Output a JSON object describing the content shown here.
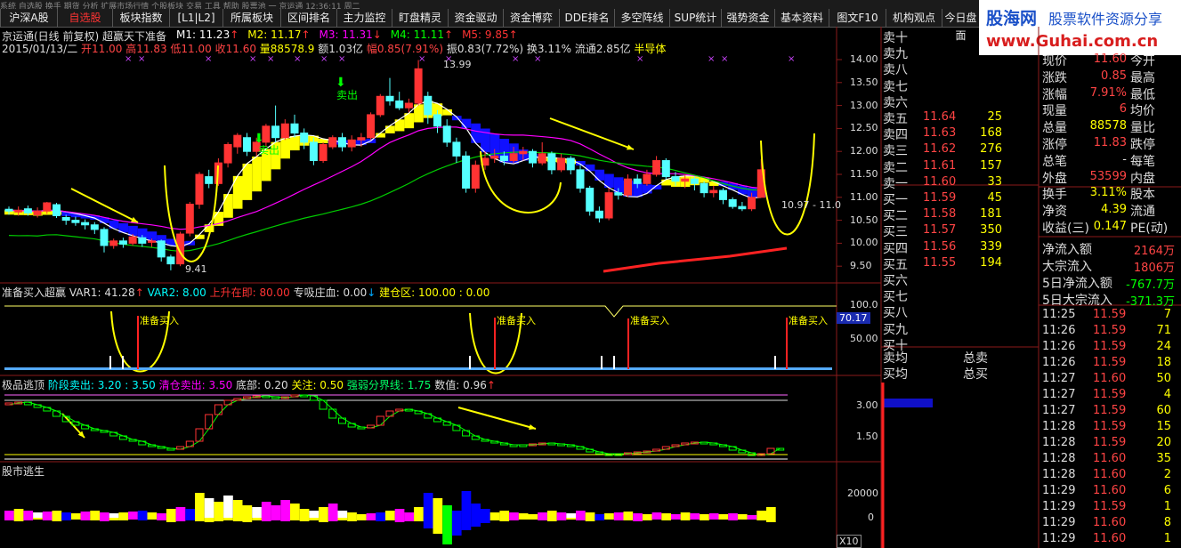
{
  "toolbar": {
    "top_strip": "系统 自选股 换手 期货 分析 扩展市场行情 个股板块 交易 工具 帮助 股票池 一 京运通 12:36:11 周二",
    "tabs": [
      {
        "label": "沪深A股",
        "active": false
      },
      {
        "label": "自选股",
        "active": true
      },
      {
        "label": "板块指数",
        "active": false
      },
      {
        "label": "[L1|L2]",
        "active": false
      },
      {
        "label": "所属板块",
        "active": false
      },
      {
        "label": "区间排名",
        "active": false
      },
      {
        "label": "主力监控",
        "active": false
      },
      {
        "label": "盯盘精灵",
        "active": false
      },
      {
        "label": "资金驱动",
        "active": false
      },
      {
        "label": "资金博弈",
        "active": false
      },
      {
        "label": "DDE排名",
        "active": false
      },
      {
        "label": "多空阵线",
        "active": false
      },
      {
        "label": "SUP统计",
        "active": false
      },
      {
        "label": "强势资金",
        "active": false
      },
      {
        "label": "基本资料",
        "active": false
      },
      {
        "label": "图文F10",
        "active": false
      },
      {
        "label": "机构观点",
        "active": false
      },
      {
        "label": "今日盘面",
        "active": false
      }
    ]
  },
  "watermark": {
    "site_cn": "股海网",
    "slogan": "股票软件资源分享",
    "url": "www.Guhai.com.cn"
  },
  "main_chart": {
    "title": "京运通(日线 前复权) 超赢天下准备",
    "ma": [
      {
        "label": "M1: 11.23",
        "arrow": "↑",
        "color": "#ffffff"
      },
      {
        "label": "M2: 11.17",
        "arrow": "↑",
        "color": "#ffff00"
      },
      {
        "label": "M3: 11.31",
        "arrow": "↓",
        "color": "#ff00ff"
      },
      {
        "label": "M4: 11.11",
        "arrow": "↑",
        "color": "#00ff00"
      },
      {
        "label": "M5: 9.85",
        "arrow": "↑",
        "color": "#ff3333"
      }
    ],
    "date": "2015/01/13/二",
    "open": "开11.00",
    "high": "高11.83",
    "low": "低11.00",
    "close": "收11.60",
    "vol": "量88578.9",
    "amt": "额1.03亿",
    "chg": "幅0.85(7.91%)",
    "amp": "振0.83(7.72%)",
    "turn": "换3.11%",
    "float": "流通2.85亿",
    "sector": "半导体",
    "sell_label": "卖出",
    "high_mark": "13.99",
    "low_mark": "9.41",
    "last_mark": "10.97 - 11.0",
    "yticks": [
      "14.00",
      "13.50",
      "13.00",
      "12.50",
      "12.00",
      "11.50",
      "11.00",
      "10.50",
      "10.00",
      "9.50"
    ]
  },
  "panel2": {
    "title": "准备买入超赢",
    "var1": "VAR1: 41.28",
    "var2": "VAR2: 8.00",
    "up": "上升在即: 80.00",
    "zhuang": "专吸庄血: 0.00",
    "jian": "建仓区: 100.00 : 0.00",
    "buy_label": "准备买入",
    "yticks": [
      "100.0",
      "50.00"
    ],
    "cur": "70.17"
  },
  "panel3": {
    "title": "极品逃顶",
    "s1": "阶段卖出: 3.20 : 3.50",
    "s2": "清仓卖出: 3.50",
    "s3": "底部: 0.20",
    "s4": "关注: 0.50",
    "s5": "强弱分界线: 1.75",
    "s6": "数值: 0.96",
    "yticks": [
      "3.00",
      "1.50"
    ]
  },
  "panel4": {
    "title": "股市逃生",
    "yticks": [
      "20000",
      "0"
    ],
    "scale": "X10"
  },
  "orderbook": {
    "sell": [
      {
        "label": "卖十",
        "price": "",
        "vol": ""
      },
      {
        "label": "卖九",
        "price": "",
        "vol": ""
      },
      {
        "label": "卖八",
        "price": "",
        "vol": ""
      },
      {
        "label": "卖七",
        "price": "",
        "vol": ""
      },
      {
        "label": "卖六",
        "price": "",
        "vol": ""
      },
      {
        "label": "卖五",
        "price": "11.64",
        "vol": "25"
      },
      {
        "label": "卖四",
        "price": "11.63",
        "vol": "168"
      },
      {
        "label": "卖三",
        "price": "11.62",
        "vol": "276"
      },
      {
        "label": "卖二",
        "price": "11.61",
        "vol": "157"
      },
      {
        "label": "卖一",
        "price": "11.60",
        "vol": "33"
      }
    ],
    "buy": [
      {
        "label": "买一",
        "price": "11.59",
        "vol": "45"
      },
      {
        "label": "买二",
        "price": "11.58",
        "vol": "181"
      },
      {
        "label": "买三",
        "price": "11.57",
        "vol": "350"
      },
      {
        "label": "买四",
        "price": "11.56",
        "vol": "339"
      },
      {
        "label": "买五",
        "price": "11.55",
        "vol": "194"
      },
      {
        "label": "买六",
        "price": "",
        "vol": ""
      },
      {
        "label": "买七",
        "price": "",
        "vol": ""
      },
      {
        "label": "买八",
        "price": "",
        "vol": ""
      },
      {
        "label": "买九",
        "price": "",
        "vol": ""
      },
      {
        "label": "买十",
        "price": "",
        "vol": ""
      }
    ],
    "avg_sell": "卖均",
    "avg_buy": "买均",
    "total_sell": "总卖",
    "total_buy": "总买"
  },
  "quote": [
    {
      "label": "现价",
      "value": "11.60",
      "color": "#ff4444",
      "label2": "今开"
    },
    {
      "label": "涨跌",
      "value": "0.85",
      "color": "#ff4444",
      "label2": "最高"
    },
    {
      "label": "涨幅",
      "value": "7.91%",
      "color": "#ff4444",
      "label2": "最低"
    },
    {
      "label": "现量",
      "value": "6",
      "color": "#ff4444",
      "label2": "均价"
    },
    {
      "label": "总量",
      "value": "88578",
      "color": "#ffff00",
      "label2": "量比"
    },
    {
      "label": "涨停",
      "value": "11.83",
      "color": "#ff4444",
      "label2": "跌停"
    },
    {
      "label": "总笔",
      "value": "-",
      "color": "#dddddd",
      "label2": "每笔"
    },
    {
      "label": "外盘",
      "value": "53599",
      "color": "#ff4444",
      "label2": "内盘"
    },
    {
      "label": "换手",
      "value": "3.11%",
      "color": "#ffff00",
      "label2": "股本"
    },
    {
      "label": "净资",
      "value": "4.39",
      "color": "#ffff00",
      "label2": "流通"
    },
    {
      "label": "收益(三)",
      "value": "0.147",
      "color": "#ffff00",
      "label2": "PE(动)"
    }
  ],
  "flows": [
    {
      "label": "净流入额",
      "value": "2164万",
      "color": "#ff4444"
    },
    {
      "label": "大宗流入",
      "value": "1806万",
      "color": "#ff4444"
    },
    {
      "label": "5日净流入额",
      "value": "-767.7万",
      "color": "#00ff00"
    },
    {
      "label": "5日大宗流入",
      "value": "-371.3万",
      "color": "#00ff00"
    }
  ],
  "ticks": [
    {
      "time": "11:25",
      "price": "11.59",
      "vol": "7"
    },
    {
      "time": "11:26",
      "price": "11.59",
      "vol": "71"
    },
    {
      "time": "11:26",
      "price": "11.59",
      "vol": "24"
    },
    {
      "time": "11:26",
      "price": "11.59",
      "vol": "18"
    },
    {
      "time": "11:27",
      "price": "11.60",
      "vol": "50"
    },
    {
      "time": "11:27",
      "price": "11.59",
      "vol": "4"
    },
    {
      "time": "11:27",
      "price": "11.59",
      "vol": "60"
    },
    {
      "time": "11:28",
      "price": "11.59",
      "vol": "15"
    },
    {
      "time": "11:28",
      "price": "11.59",
      "vol": "20"
    },
    {
      "time": "11:28",
      "price": "11.60",
      "vol": "35"
    },
    {
      "time": "11:28",
      "price": "11.60",
      "vol": "2"
    },
    {
      "time": "11:29",
      "price": "11.60",
      "vol": "6"
    },
    {
      "time": "11:29",
      "price": "11.59",
      "vol": "1"
    },
    {
      "time": "11:29",
      "price": "11.60",
      "vol": "8"
    },
    {
      "time": "11:29",
      "price": "11.60",
      "vol": "1"
    }
  ],
  "colors": {
    "up": "#ff3333",
    "down": "#54ffff",
    "ma_yellow": "#ffff00",
    "ma_magenta": "#ff00ff",
    "ma_green": "#00cc00",
    "blue_band": "#1010ff"
  }
}
